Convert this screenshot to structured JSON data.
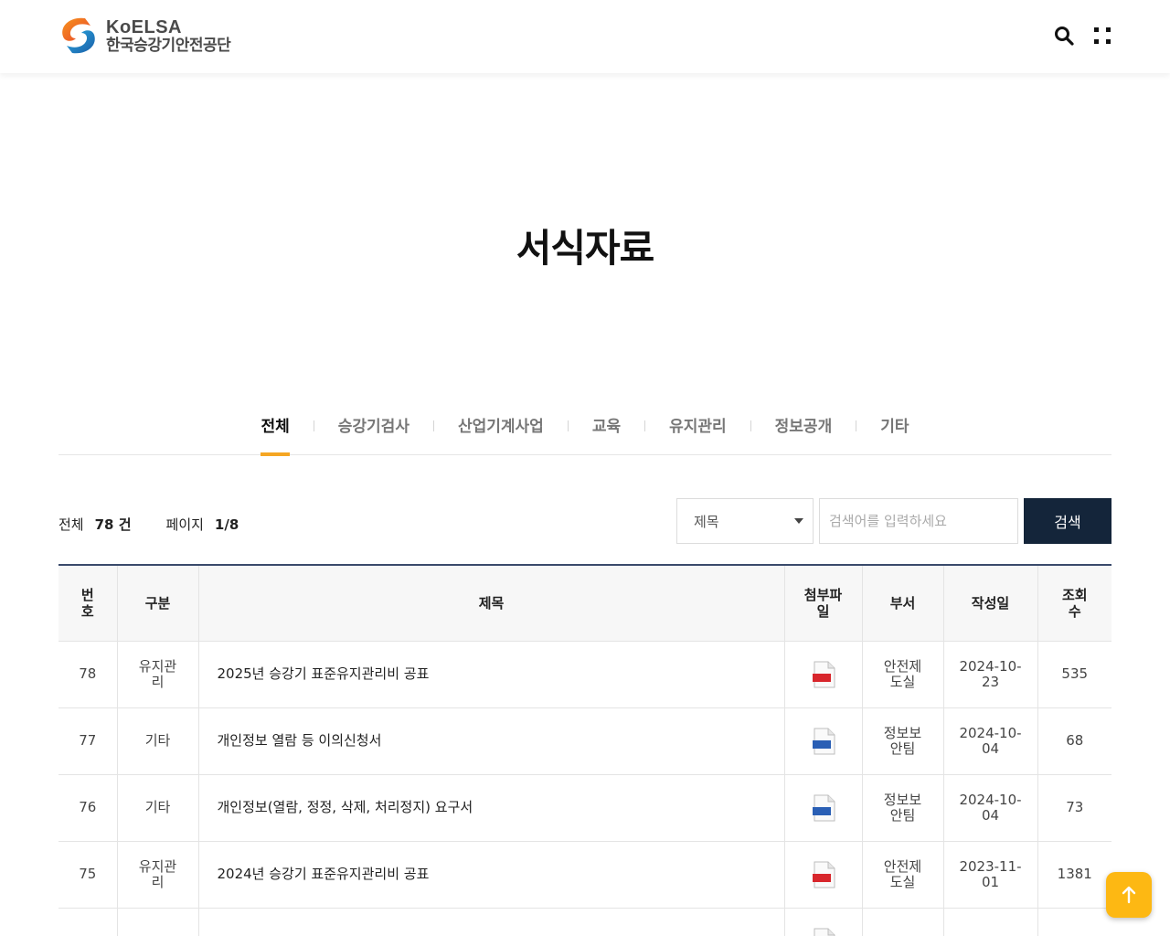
{
  "header": {
    "logo_en": "KoELSA",
    "logo_ko": "한국승강기안전공단",
    "icons": [
      "search-icon",
      "menu-grid-icon"
    ]
  },
  "page_title": "서식자료",
  "tabs": [
    {
      "label": "전체",
      "active": true
    },
    {
      "label": "승강기검사",
      "active": false
    },
    {
      "label": "산업기계사업",
      "active": false
    },
    {
      "label": "교육",
      "active": false
    },
    {
      "label": "유지관리",
      "active": false
    },
    {
      "label": "정보공개",
      "active": false
    },
    {
      "label": "기타",
      "active": false
    }
  ],
  "summary": {
    "total_label": "전체",
    "total_value": "78 건",
    "page_label": "페이지",
    "page_value": "1/8"
  },
  "search": {
    "select_value": "제목",
    "placeholder": "검색어를 입력하세요",
    "button_label": "검색"
  },
  "table": {
    "columns": [
      "번\n호",
      "구분",
      "제목",
      "첨부파\n일",
      "부서",
      "작성일",
      "조회\n수"
    ],
    "rows": [
      {
        "no": "78",
        "category": "유지관\n리",
        "title": "2025년 승강기 표준유지관리비 공표",
        "file": "pdf",
        "dept": "안전제\n도실",
        "date": "2024-10-\n23",
        "views": "535"
      },
      {
        "no": "77",
        "category": "기타",
        "title": "개인정보 열람 등 이의신청서",
        "file": "hwp",
        "dept": "정보보\n안팀",
        "date": "2024-10-\n04",
        "views": "68"
      },
      {
        "no": "76",
        "category": "기타",
        "title": "개인정보(열람, 정정, 삭제, 처리정지) 요구서",
        "file": "hwp",
        "dept": "정보보\n안팀",
        "date": "2024-10-\n04",
        "views": "73"
      },
      {
        "no": "75",
        "category": "유지관\n리",
        "title": "2024년 승강기 표준유지관리비 공표",
        "file": "pdf",
        "dept": "안전제\n도실",
        "date": "2023-11-\n01",
        "views": "1381"
      },
      {
        "no": "",
        "category": "",
        "title": "",
        "file": "blank",
        "dept": "",
        "date": "",
        "views": ""
      }
    ]
  },
  "colors": {
    "accent": "#f5a623",
    "search_button": "#14253a",
    "top_button": "#fdb813",
    "table_top_border": "#3a4a6b"
  },
  "top_button_icon": "arrow-up-icon"
}
